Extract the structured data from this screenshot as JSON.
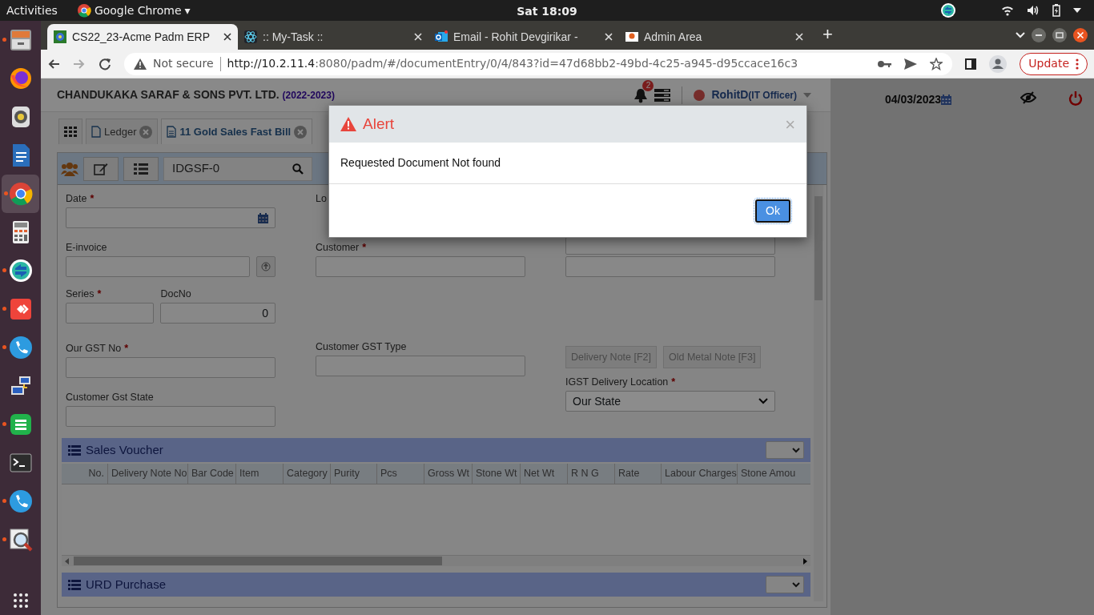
{
  "system_bar": {
    "activities": "Activities",
    "app_menu": "Google Chrome",
    "app_menu_caret": "▾",
    "clock": "Sat 18:09"
  },
  "dock": {
    "items": [
      {
        "kind": "files",
        "running": true,
        "selected": false
      },
      {
        "kind": "firefox",
        "running": false,
        "selected": false
      },
      {
        "kind": "media",
        "running": false,
        "selected": false
      },
      {
        "kind": "writer",
        "running": false,
        "selected": false
      },
      {
        "kind": "chrome",
        "running": true,
        "selected": true
      },
      {
        "kind": "calculator",
        "running": false,
        "selected": false
      },
      {
        "kind": "sync",
        "running": true,
        "selected": false
      },
      {
        "kind": "remote",
        "running": true,
        "selected": false
      },
      {
        "kind": "phone",
        "running": true,
        "selected": false
      },
      {
        "kind": "network",
        "running": false,
        "selected": false
      },
      {
        "kind": "sheet",
        "running": true,
        "selected": false
      },
      {
        "kind": "terminal",
        "running": false,
        "selected": false
      },
      {
        "kind": "phone",
        "running": true,
        "selected": false
      },
      {
        "kind": "viewer",
        "running": true,
        "selected": false
      }
    ]
  },
  "browser": {
    "tabs": [
      {
        "title": "CS22_23-Acme Padm ERP",
        "kind": "erp",
        "selected": true
      },
      {
        "title": ":: My-Task ::",
        "kind": "react",
        "selected": false
      },
      {
        "title": "Email - Rohit Devgirikar -",
        "kind": "mail",
        "selected": false
      },
      {
        "title": "Admin Area",
        "kind": "admin",
        "selected": false
      }
    ],
    "new_tab": "+",
    "security": "Not secure",
    "url_host": "http://10.2.11.4",
    "url_rest": ":8080/padm/#/documentEntry/0/4/843?id=47d68bb2-49bd-4c25-a945-d95ccace16c3",
    "update_button": "Update"
  },
  "app": {
    "company": "CHANDUKAKA SARAF & SONS PVT. LTD.",
    "year": "(2022-2023)",
    "notification_count": "2",
    "user": "RohitD",
    "role": "(IT Officer)",
    "date": "04/03/2023"
  },
  "doc_tabs": [
    {
      "label": "Ledger",
      "selected": false
    },
    {
      "label": "11 Gold Sales Fast Bill",
      "selected": true
    }
  ],
  "search": {
    "value": "IDGSF-0"
  },
  "form": {
    "fields": [
      {
        "label": "Date",
        "required_mark": "*",
        "kind": "date"
      },
      {
        "label": "Lo",
        "kind": "covered"
      },
      {
        "label": "E-invoice",
        "kind": "upload"
      },
      {
        "label": "Customer",
        "required_mark": "*",
        "kind": "text"
      },
      {
        "kind": "bare"
      },
      {
        "kind": "bare"
      },
      {
        "label": "Series",
        "required_mark": "*",
        "kind": "text"
      },
      {
        "label": "DocNo",
        "kind": "number",
        "value": "0"
      },
      {
        "label": "Our GST No",
        "required_mark": "*",
        "kind": "text"
      },
      {
        "label": "Customer GST Type",
        "kind": "text"
      },
      {
        "label": "Customer Gst State",
        "kind": "text"
      },
      {
        "label": "IGST Delivery Location",
        "required_mark": "*",
        "kind": "select",
        "value": "Our State"
      }
    ],
    "buttons": [
      "Delivery Note [F2]",
      "Old Metal Note [F3]"
    ]
  },
  "sections": [
    {
      "title": "Sales Voucher",
      "columns": [
        "No.",
        "Delivery Note No",
        "Bar Code",
        "Item",
        "Category",
        "Purity",
        "Pcs",
        "Gross Wt",
        "Stone Wt",
        "Net Wt",
        "R N G",
        "Rate",
        "Labour Charges",
        "Stone Amou"
      ]
    },
    {
      "title": "URD Purchase"
    }
  ],
  "modal": {
    "title": "Alert",
    "close": "×",
    "message": "Requested Document Not found",
    "ok": "Ok"
  }
}
